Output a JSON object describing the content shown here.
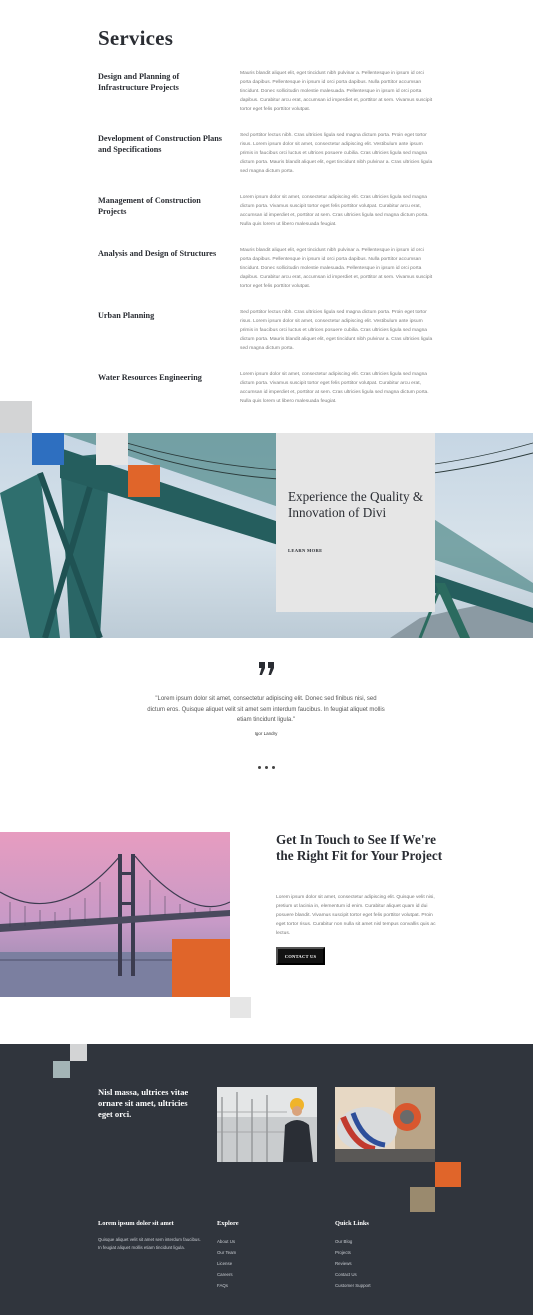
{
  "services": {
    "title": "Services",
    "items": [
      {
        "name": "Design and Planning of Infrastructure Projects",
        "desc": "Mauris blandit aliquet elit, eget tincidunt nibh pulvinar a. Pellentesque in ipsum id orci porta dapibus. Pellentesque in ipsum id orci porta dapibus. Nulla porttitor accumsan tincidunt. Donec sollicitudin molestie malesuada. Pellentesque in ipsum id orci porta dapibus. Curabitur arcu erat, accumsan id imperdiet et, porttitor at sem. Vivamus suscipit tortor eget felis porttitor volutpat."
      },
      {
        "name": "Development of Construction Plans and Specifications",
        "desc": "Sed porttitor lectus nibh. Cras ultricies ligula sed magna dictum porta. Proin eget tortor risus. Lorem ipsum dolor sit amet, consectetur adipiscing elit. Vestibulum ante ipsum primis in faucibus orci luctus et ultrices posuere cubilia. Cras ultricies ligula sed magna dictum porta. Mauris blandit aliquet elit, eget tincidunt nibh pulvinar a. Cras ultricies ligula sed magna dictum porta."
      },
      {
        "name": "Management of Construction Projects",
        "desc": "Lorem ipsum dolor sit amet, consectetur adipiscing elit. Cras ultricies ligula sed magna dictum porta. Vivamus suscipit tortor eget felis porttitor volutpat. Curabitur arcu erat, accumsan id imperdiet et, porttitor at sem. Cras ultricies ligula sed magna dictum porta. Nulla quis lorem ut libero malesuada feugiat."
      },
      {
        "name": "Analysis and Design of Structures",
        "desc": "Mauris blandit aliquet elit, eget tincidunt nibh pulvinar a. Pellentesque in ipsum id orci porta dapibus. Pellentesque in ipsum id orci porta dapibus. Nulla porttitor accumsan tincidunt. Donec sollicitudin molestie malesuada. Pellentesque in ipsum id orci porta dapibus. Curabitur arcu erat, accumsan id imperdiet et, porttitor at sem. Vivamus suscipit tortor eget felis porttitor volutpat."
      },
      {
        "name": "Urban Planning",
        "desc": "Sed porttitor lectus nibh. Cras ultricies ligula sed magna dictum porta. Proin eget tortor risus. Lorem ipsum dolor sit amet, consectetur adipiscing elit. Vestibulum ante ipsum primis in faucibus orci luctus et ultrices posuere cubilia. Cras ultricies ligula sed magna dictum porta. Mauris blandit aliquet elit, eget tincidunt nibh pulvinar a. Cras ultricies ligula sed magna dictum porta."
      },
      {
        "name": "Water Resources Engineering",
        "desc": "Lorem ipsum dolor sit amet, consectetur adipiscing elit. Cras ultricies ligula sed magna dictum porta. Vivamus suscipit tortor eget felis porttitor volutpat. Curabitur arcu erat, accumsan id imperdiet et, porttitor at sem. Cras ultricies ligula sed magna dictum porta. Nulla quis lorem ut libero malesuada feugiat."
      }
    ]
  },
  "hero": {
    "heading": "Experience the Quality & Innovation of Divi",
    "link": "LEARN MORE"
  },
  "testimonial": {
    "quote": "\"Lorem ipsum dolor sit amet, consectetur adipiscing elit. Donec sed finibus nisi, sed dictum eros. Quisque aliquet velit sit amet sem interdum faucibus. In feugiat aliquet mollis etiam tincidunt ligula.\"",
    "author": "Igor Landry"
  },
  "contact": {
    "heading": "Get In Touch to See If We're the Right Fit for Your Project",
    "text": "Lorem ipsum dolor sit amet, consectetur adipiscing elit. Quisque velit nisi, pretium ut lacinia in, elementum id enim. Curabitur aliquet quam id dui posuere blandit. Vivamus suscipit tortor eget felis porttitor volutpat. Proin eget tortor risus. Curabitur non nulla sit amet nisl tempus convallis quis ac lectus.",
    "button": "CONTACT US"
  },
  "footer": {
    "tagline": "Nisl massa, ultrices vitae ornare sit amet, ultricies eget orci.",
    "about_title": "Lorem ipsum dolor sit amet",
    "about_text": "Quisque aliquet velit sit amet sem interdum faucibus. In feugiat aliquet mollis etiam tincidunt ligula.",
    "explore_title": "Explore",
    "explore_links": [
      "About Us",
      "Our Team",
      "License",
      "Careers",
      "FAQs"
    ],
    "quick_title": "Quick Links",
    "quick_links": [
      "Our Blog",
      "Projects",
      "Reviews",
      "Contact Us",
      "Customer Support"
    ]
  },
  "colors": {
    "accent_orange": "#e0652a",
    "accent_blue": "#2e6fc0",
    "dark": "#30353d",
    "light_gray": "#e6e6e6"
  }
}
